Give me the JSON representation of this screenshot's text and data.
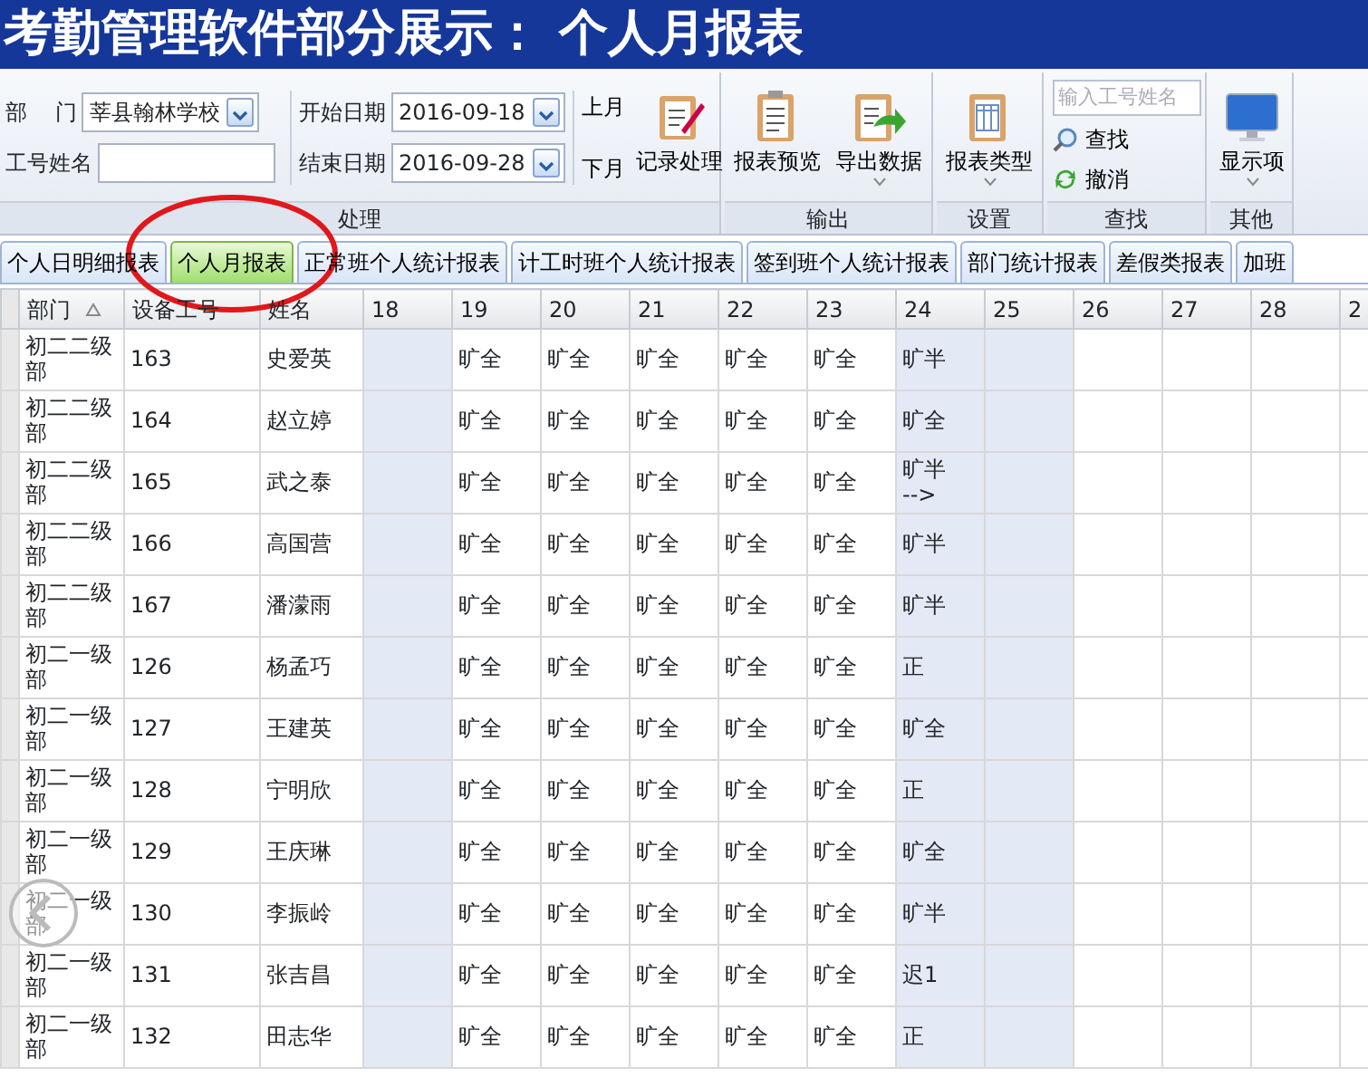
{
  "banner": {
    "title": "考勤管理软件部分展示： 个人月报表"
  },
  "ribbon": {
    "process": {
      "label": "处理",
      "dept_label": "部    门",
      "dept_value": "莘县翰林学校",
      "staff_label": "工号姓名",
      "start_label": "开始日期",
      "start_value": "2016-09-18",
      "end_label": "结束日期",
      "end_value": "2016-09-28",
      "prev_month": "上月",
      "next_month": "下月",
      "buttons": [
        {
          "label": "记录处理",
          "kind": "edit",
          "dropdown": false
        }
      ]
    },
    "output": {
      "label": "输出",
      "buttons": [
        {
          "label": "报表预览",
          "kind": "list",
          "dropdown": false
        },
        {
          "label": "导出数据",
          "kind": "export",
          "dropdown": true
        }
      ]
    },
    "settings": {
      "label": "设置",
      "buttons": [
        {
          "label": "报表类型",
          "kind": "table",
          "dropdown": true
        }
      ]
    },
    "search": {
      "label": "查找",
      "placeholder": "输入工号姓名",
      "find": "查找",
      "undo": "撤消"
    },
    "other": {
      "label": "其他",
      "buttons": [
        {
          "label": "显示项",
          "kind": "monitor",
          "dropdown": true
        }
      ]
    }
  },
  "tabs": [
    {
      "label": "个人日明细报表",
      "selected": false
    },
    {
      "label": "个人月报表",
      "selected": true
    },
    {
      "label": "正常班个人统计报表",
      "selected": false
    },
    {
      "label": "计工时班个人统计报表",
      "selected": false
    },
    {
      "label": "签到班个人统计报表",
      "selected": false
    },
    {
      "label": "部门统计报表",
      "selected": false
    },
    {
      "label": "差假类报表",
      "selected": false
    },
    {
      "label": "加班",
      "selected": false
    }
  ],
  "table": {
    "columns": [
      {
        "label": "部门",
        "sort_icon": true
      },
      {
        "label": "设备工号",
        "sort_icon": false
      },
      {
        "label": "姓名",
        "sort_icon": false
      }
    ],
    "date_columns": [
      {
        "label": "18",
        "weekend": true
      },
      {
        "label": "19",
        "weekend": false
      },
      {
        "label": "20",
        "weekend": false
      },
      {
        "label": "21",
        "weekend": false
      },
      {
        "label": "22",
        "weekend": false
      },
      {
        "label": "23",
        "weekend": false
      },
      {
        "label": "24",
        "weekend": true
      },
      {
        "label": "25",
        "weekend": true
      },
      {
        "label": "26",
        "weekend": false
      },
      {
        "label": "27",
        "weekend": false
      },
      {
        "label": "28",
        "weekend": false
      },
      {
        "label": "2",
        "weekend": false
      }
    ],
    "rows": [
      {
        "dept": "初二二级部",
        "id": "163",
        "name": "史爱英",
        "days_from_19": [
          "旷全",
          "旷全",
          "旷全",
          "旷全",
          "旷全",
          "旷半"
        ]
      },
      {
        "dept": "初二二级部",
        "id": "164",
        "name": "赵立婷",
        "days_from_19": [
          "旷全",
          "旷全",
          "旷全",
          "旷全",
          "旷全",
          "旷全"
        ]
      },
      {
        "dept": "初二二级部",
        "id": "165",
        "name": "武之泰",
        "days_from_19": [
          "旷全",
          "旷全",
          "旷全",
          "旷全",
          "旷全",
          "旷半\n-->"
        ]
      },
      {
        "dept": "初二二级部",
        "id": "166",
        "name": "高国营",
        "days_from_19": [
          "旷全",
          "旷全",
          "旷全",
          "旷全",
          "旷全",
          "旷半"
        ]
      },
      {
        "dept": "初二二级部",
        "id": "167",
        "name": "潘濛雨",
        "days_from_19": [
          "旷全",
          "旷全",
          "旷全",
          "旷全",
          "旷全",
          "旷半"
        ]
      },
      {
        "dept": "初二一级部",
        "id": "126",
        "name": "杨孟巧",
        "days_from_19": [
          "旷全",
          "旷全",
          "旷全",
          "旷全",
          "旷全",
          "正"
        ]
      },
      {
        "dept": "初二一级部",
        "id": "127",
        "name": "王建英",
        "days_from_19": [
          "旷全",
          "旷全",
          "旷全",
          "旷全",
          "旷全",
          "旷全"
        ]
      },
      {
        "dept": "初二一级部",
        "id": "128",
        "name": "宁明欣",
        "days_from_19": [
          "旷全",
          "旷全",
          "旷全",
          "旷全",
          "旷全",
          "正"
        ]
      },
      {
        "dept": "初二一级部",
        "id": "129",
        "name": "王庆琳",
        "days_from_19": [
          "旷全",
          "旷全",
          "旷全",
          "旷全",
          "旷全",
          "旷全"
        ]
      },
      {
        "dept": "初二一级部",
        "id": "130",
        "name": "李振岭",
        "days_from_19": [
          "旷全",
          "旷全",
          "旷全",
          "旷全",
          "旷全",
          "旷半"
        ]
      },
      {
        "dept": "初二一级部",
        "id": "131",
        "name": "张吉昌",
        "days_from_19": [
          "旷全",
          "旷全",
          "旷全",
          "旷全",
          "旷全",
          "迟1"
        ]
      },
      {
        "dept": "初二一级部",
        "id": "132",
        "name": "田志华",
        "days_from_19": [
          "旷全",
          "旷全",
          "旷全",
          "旷全",
          "旷全",
          "正"
        ]
      }
    ]
  }
}
